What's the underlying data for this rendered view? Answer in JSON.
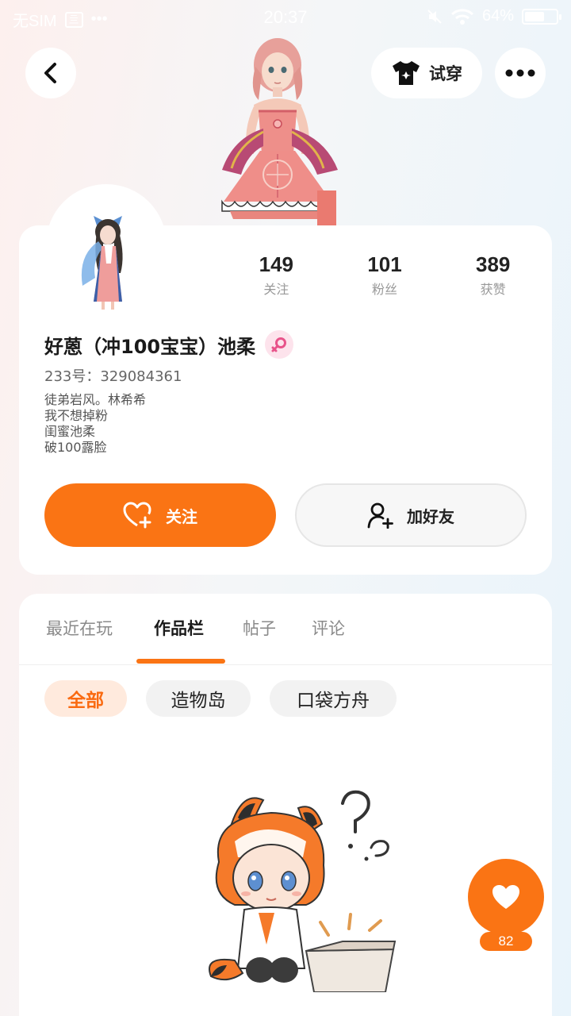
{
  "status_bar": {
    "carrier": "无SIM",
    "sim_label": "亖",
    "dots": "•••",
    "time": "20:37",
    "battery": "64%",
    "battery_level": 0.64
  },
  "header": {
    "back_icon": "chevron-left-icon",
    "try_on_label": "试穿",
    "try_on_icon": "tshirt-icon",
    "more_icon": "more-horizontal-icon"
  },
  "profile": {
    "stats": [
      {
        "value": "149",
        "label": "关注"
      },
      {
        "value": "101",
        "label": "粉丝"
      },
      {
        "value": "389",
        "label": "获赞"
      }
    ],
    "username": "好蒽（冲100宝宝）池柔",
    "gender_icon": "female-icon",
    "uid": "233号：329084361",
    "bio": "徒弟岩风。林希希\n我不想掉粉\n闺蜜池柔\n破100露脸",
    "follow_label": "关注",
    "add_friend_label": "加好友"
  },
  "tabs": [
    {
      "label": "最近在玩",
      "active": false
    },
    {
      "label": "作品栏",
      "active": true
    },
    {
      "label": "帖子",
      "active": false
    },
    {
      "label": "评论",
      "active": false
    }
  ],
  "filters": [
    {
      "label": "全部",
      "active": true
    },
    {
      "label": "造物岛",
      "active": false
    },
    {
      "label": "口袋方舟",
      "active": false
    }
  ],
  "like": {
    "count": "82"
  },
  "colors": {
    "accent": "#fa7414",
    "accent_light": "#ffeadd",
    "gender_pink": "#e8538a"
  }
}
